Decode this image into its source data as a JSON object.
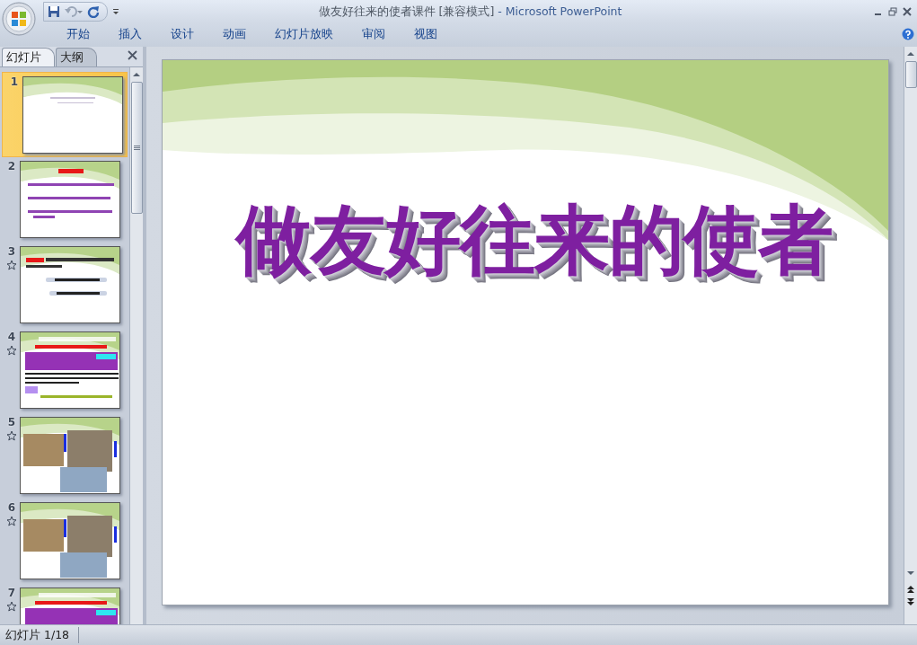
{
  "window": {
    "document": "做友好往来的使者课件 [兼容模式]",
    "app": "- Microsoft PowerPoint"
  },
  "ribbon_tabs": [
    {
      "label": "开始",
      "selected": false
    },
    {
      "label": "插入",
      "selected": false
    },
    {
      "label": "设计",
      "selected": false
    },
    {
      "label": "动画",
      "selected": false
    },
    {
      "label": "幻灯片放映",
      "selected": false
    },
    {
      "label": "审阅",
      "selected": false
    },
    {
      "label": "视图",
      "selected": false
    }
  ],
  "pane_tabs": [
    {
      "label": "幻灯片",
      "selected": true
    },
    {
      "label": "大纲",
      "selected": false
    }
  ],
  "thumbnails": [
    {
      "number": "1",
      "selected": true,
      "animated": false,
      "kind": "title"
    },
    {
      "number": "2",
      "selected": false,
      "animated": false,
      "kind": "list"
    },
    {
      "number": "3",
      "selected": false,
      "animated": true,
      "kind": "bars"
    },
    {
      "number": "4",
      "selected": false,
      "animated": true,
      "kind": "text"
    },
    {
      "number": "5",
      "selected": false,
      "animated": true,
      "kind": "photos"
    },
    {
      "number": "6",
      "selected": false,
      "animated": true,
      "kind": "photos"
    },
    {
      "number": "7",
      "selected": false,
      "animated": true,
      "kind": "text"
    }
  ],
  "slide": {
    "title": "做友好往来的使者"
  },
  "status_bar": {
    "slide_indicator": "幻灯片 1/18"
  }
}
